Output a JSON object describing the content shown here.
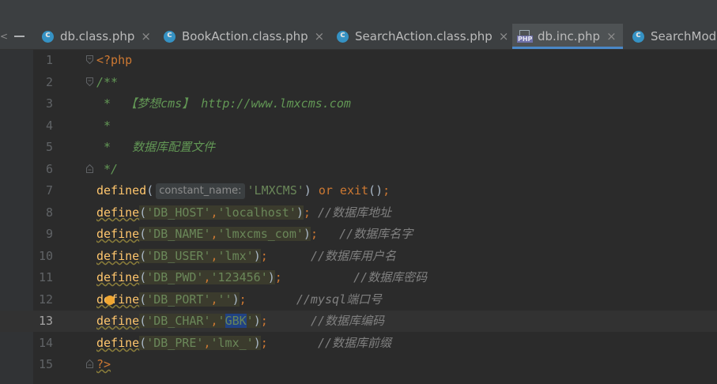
{
  "tabs": [
    {
      "label": "db.class.php",
      "icon": "php-class-icon",
      "close": "×",
      "active": false
    },
    {
      "label": "BookAction.class.php",
      "icon": "php-class-icon",
      "close": "×",
      "active": false
    },
    {
      "label": "SearchAction.class.php",
      "icon": "php-class-icon",
      "close": "×",
      "active": false
    },
    {
      "label": "db.inc.php",
      "icon": "php-file-icon",
      "close": "×",
      "active": true
    },
    {
      "label": "SearchMod",
      "icon": "php-class-icon",
      "close": "",
      "active": false
    }
  ],
  "php_badge": "PHP",
  "hint_label": "constant_name:",
  "current_line": 13,
  "lines": [
    {
      "n": "1"
    },
    {
      "n": "2"
    },
    {
      "n": "3"
    },
    {
      "n": "4"
    },
    {
      "n": "5"
    },
    {
      "n": "6"
    },
    {
      "n": "7"
    },
    {
      "n": "8"
    },
    {
      "n": "9"
    },
    {
      "n": "10"
    },
    {
      "n": "11"
    },
    {
      "n": "12"
    },
    {
      "n": "13"
    },
    {
      "n": "14"
    },
    {
      "n": "15"
    }
  ],
  "code": {
    "l1": "<?php",
    "l2": "/**",
    "l3_star": " *  ",
    "l3_title": "【梦想cms】",
    "l3_url": " http://www.lmxcms.com",
    "l4": " *",
    "l5_star": " *   ",
    "l5_text": "数据库配置文件",
    "l6": " */",
    "defined": "defined",
    "define": "define",
    "de": "de",
    "fine": "fine",
    "lmxcms": "'LMXCMS'",
    "or": "or",
    "exit": "exit",
    "db_host_key": "'DB_HOST'",
    "db_host_val": "'localhost'",
    "db_host_cmt": "//数据库地址",
    "db_name_key": "'DB_NAME'",
    "db_name_val": "'lmxcms_com'",
    "db_name_cmt": "//数据库名字",
    "db_user_key": "'DB_USER'",
    "db_user_val": "'lmx'",
    "db_user_cmt": "//数据库用户名",
    "db_pwd_key": "'DB_PWD'",
    "db_pwd_val": "'123456'",
    "db_pwd_cmt": "//数据库密码",
    "db_port_key": "'DB_PORT'",
    "db_port_val": "''",
    "db_port_cmt": "//mysql端口号",
    "db_char_key": "'DB_CHAR'",
    "db_char_q": "'",
    "db_char_sel": "GBK",
    "db_char_cmt": "//数据库编码",
    "db_pre_key": "'DB_PRE'",
    "db_pre_val": "'lmx_'",
    "db_pre_cmt": "//数据库前缀",
    "l15": "?>"
  }
}
